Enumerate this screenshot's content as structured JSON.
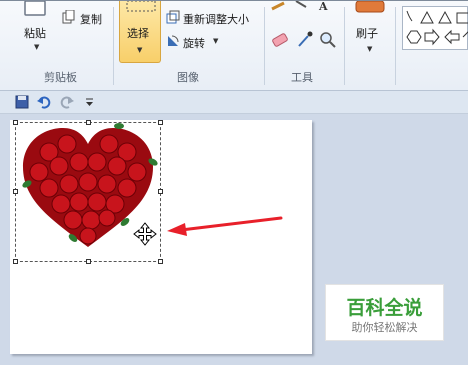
{
  "ribbon": {
    "clipboard": {
      "paste_label": "粘贴",
      "copy_label": "复制",
      "group_label": "剪贴板"
    },
    "image": {
      "select_label": "选择",
      "resize_label": "重新调整大小",
      "rotate_label": "旋转",
      "group_label": "图像"
    },
    "tools": {
      "group_label": "工具"
    },
    "brushes": {
      "label": "刷子"
    }
  },
  "watermark": {
    "title": "百科全说",
    "subtitle": "助你轻松解决"
  },
  "colors": {
    "select_highlight": "#f8cf6a",
    "arrow": "#e8202a",
    "watermark_green": "#3a9e3a"
  }
}
